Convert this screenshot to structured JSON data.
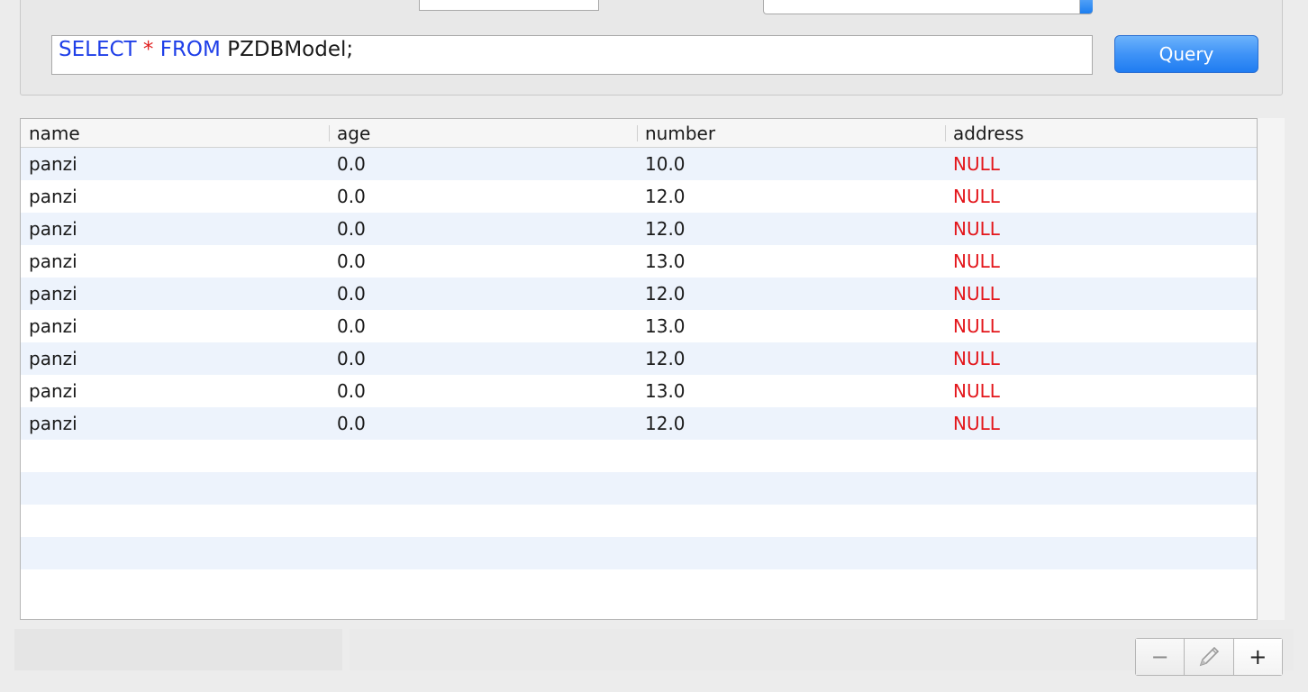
{
  "query": {
    "sql_parts": [
      {
        "text": "SELECT",
        "kind": "keyword"
      },
      {
        "text": " ",
        "kind": "ident"
      },
      {
        "text": "*",
        "kind": "star"
      },
      {
        "text": " ",
        "kind": "ident"
      },
      {
        "text": "FROM",
        "kind": "keyword"
      },
      {
        "text": " PZDBModel;",
        "kind": "ident"
      }
    ],
    "button_label": "Query"
  },
  "table": {
    "columns": [
      "name",
      "age",
      "number",
      "address"
    ],
    "rows": [
      [
        "panzi",
        "0.0",
        "10.0",
        "NULL"
      ],
      [
        "panzi",
        "0.0",
        "12.0",
        "NULL"
      ],
      [
        "panzi",
        "0.0",
        "12.0",
        "NULL"
      ],
      [
        "panzi",
        "0.0",
        "13.0",
        "NULL"
      ],
      [
        "panzi",
        "0.0",
        "12.0",
        "NULL"
      ],
      [
        "panzi",
        "0.0",
        "13.0",
        "NULL"
      ],
      [
        "panzi",
        "0.0",
        "12.0",
        "NULL"
      ],
      [
        "panzi",
        "0.0",
        "13.0",
        "NULL"
      ],
      [
        "panzi",
        "0.0",
        "12.0",
        "NULL"
      ]
    ],
    "empty_rows": 5,
    "colors": {
      "null_text": "#e3161b",
      "stripe": "#edf3fc"
    }
  },
  "toolbar": {
    "remove_label": "−",
    "edit_icon": "pencil-icon",
    "add_label": "+"
  }
}
